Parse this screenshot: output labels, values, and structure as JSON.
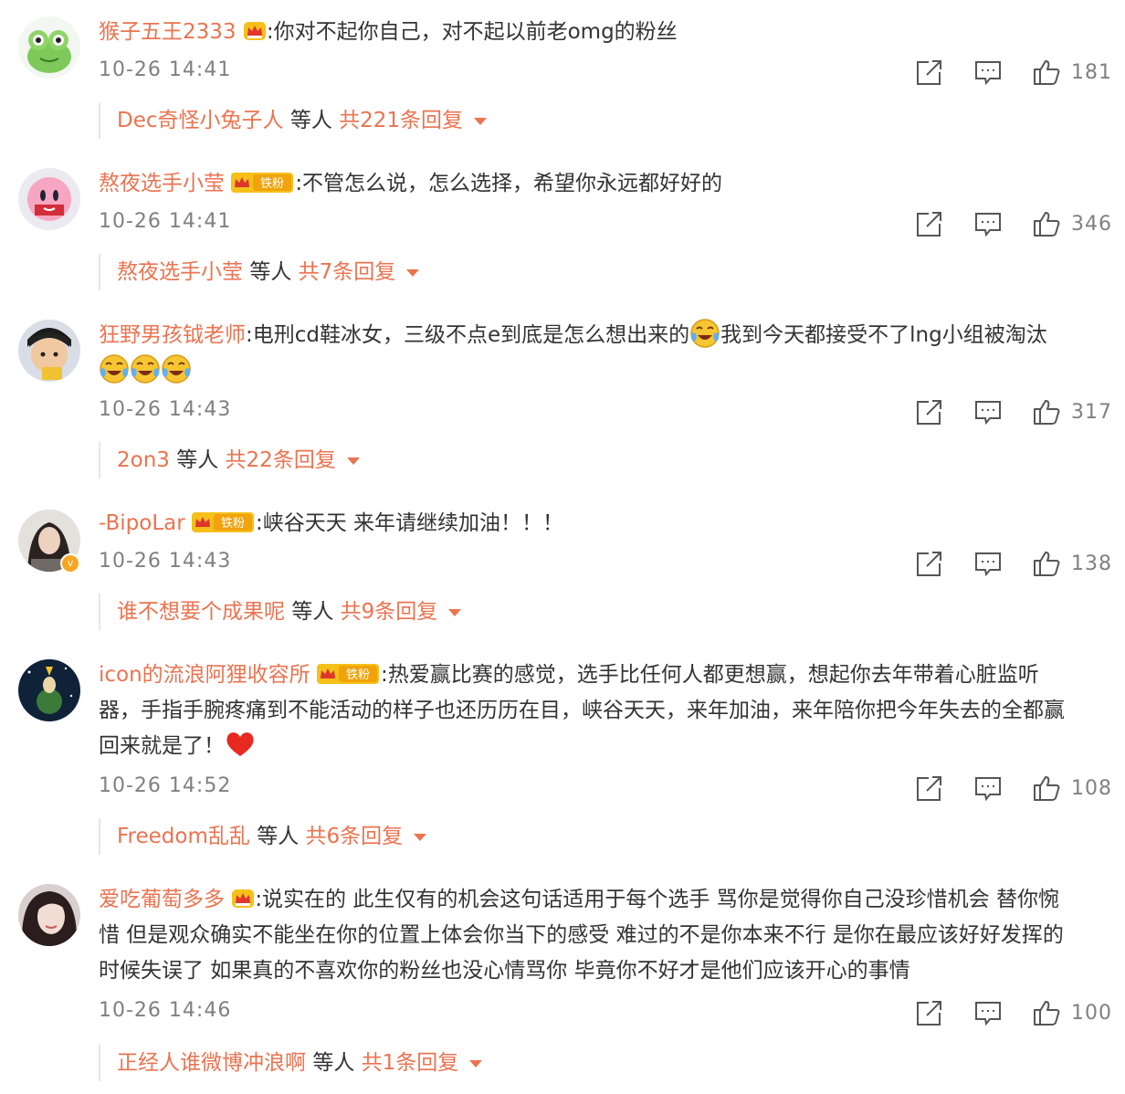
{
  "comments": [
    {
      "username": "猴子五王2333",
      "text": ":你对不起你自己，对不起以前老omg的粉丝",
      "time": "10-26 14:41",
      "likes": "181",
      "reply": {
        "names": "Dec奇怪小兔子人",
        "mid": "等人",
        "count": "共221条回复"
      }
    },
    {
      "username": "熬夜选手小莹",
      "fan_badge": "铁粉",
      "text": ":不管怎么说，怎么选择，希望你永远都好好的",
      "time": "10-26 14:41",
      "likes": "346",
      "reply": {
        "names": "熬夜选手小莹",
        "mid": "等人",
        "count": "共7条回复"
      }
    },
    {
      "username": "狂野男孩钺老师",
      "text1": ":电刑cd鞋冰女，三级不点e到底是怎么想出来的",
      "text2": "我到今天都接受不了lng小组被淘汰",
      "time": "10-26 14:43",
      "likes": "317",
      "reply": {
        "names": "2on3",
        "mid": "等人",
        "count": "共22条回复"
      }
    },
    {
      "username": "-BipoLar",
      "fan_badge": "铁粉",
      "text": ":峡谷天天 来年请继续加油！！！",
      "time": "10-26 14:43",
      "likes": "138",
      "reply": {
        "names": "谁不想要个成果呢",
        "mid": "等人",
        "count": "共9条回复"
      }
    },
    {
      "username": "icon的流浪阿狸收容所",
      "fan_badge": "铁粉",
      "line1": ":热爱赢比赛的感觉，选手比任何人都更想赢，想起你去年带着心脏监听",
      "line2": "器，手指手腕疼痛到不能活动的样子也还历历在目，峡谷天天，来年加油，来年陪你把今年失去的全都赢",
      "line3": "回来就是了！",
      "time": "10-26 14:52",
      "likes": "108",
      "reply": {
        "names": "Freedom乱乱",
        "mid": "等人",
        "count": "共6条回复"
      }
    },
    {
      "username": "爱吃葡萄多多",
      "line1": ":说实在的 此生仅有的机会这句话适用于每个选手 骂你是觉得你自己没珍惜机会 替你惋",
      "line2": "惜 但是观众确实不能坐在你的位置上体会你当下的感受 难过的不是你本来不行 是你在最应该好好发挥的",
      "line3": "时候失误了 如果真的不喜欢你的粉丝也没心情骂你 毕竟你不好才是他们应该开心的事情",
      "time": "10-26 14:46",
      "likes": "100",
      "reply": {
        "names": "正经人谁微博冲浪啊",
        "mid": "等人",
        "count": "共1条回复"
      }
    }
  ],
  "icons": {
    "share": "share-icon",
    "comment": "comment-icon",
    "like": "thumbs-up-icon",
    "crown": "crown-badge-icon",
    "emoji_cry": "laugh-cry-emoji",
    "heart": "red-heart-emoji"
  },
  "colors": {
    "username": "#eb7350",
    "text": "#333333",
    "meta": "#808080"
  }
}
